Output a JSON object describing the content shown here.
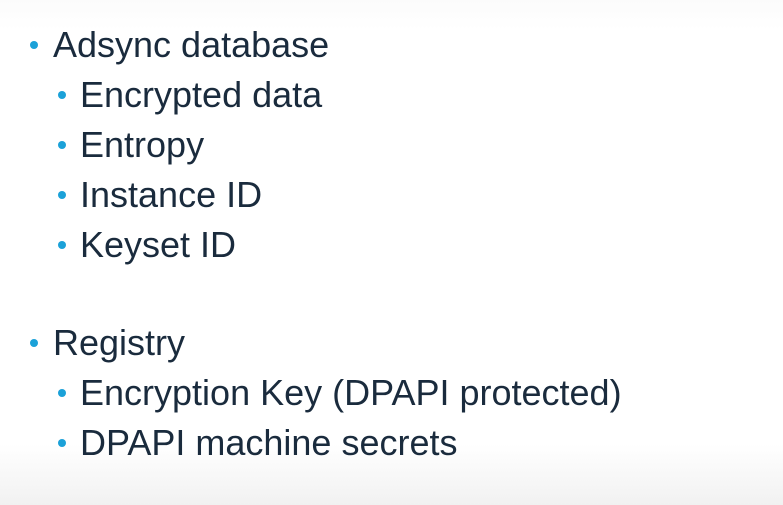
{
  "slide": {
    "groups": [
      {
        "heading": "Adsync database",
        "items": [
          "Encrypted data",
          "Entropy",
          "Instance ID",
          "Keyset ID"
        ]
      },
      {
        "heading": "Registry",
        "items": [
          "Encryption Key (DPAPI protected)",
          "DPAPI machine secrets"
        ]
      }
    ],
    "bullet_color": "#1ba1d8",
    "text_color": "#1a2b3d"
  }
}
